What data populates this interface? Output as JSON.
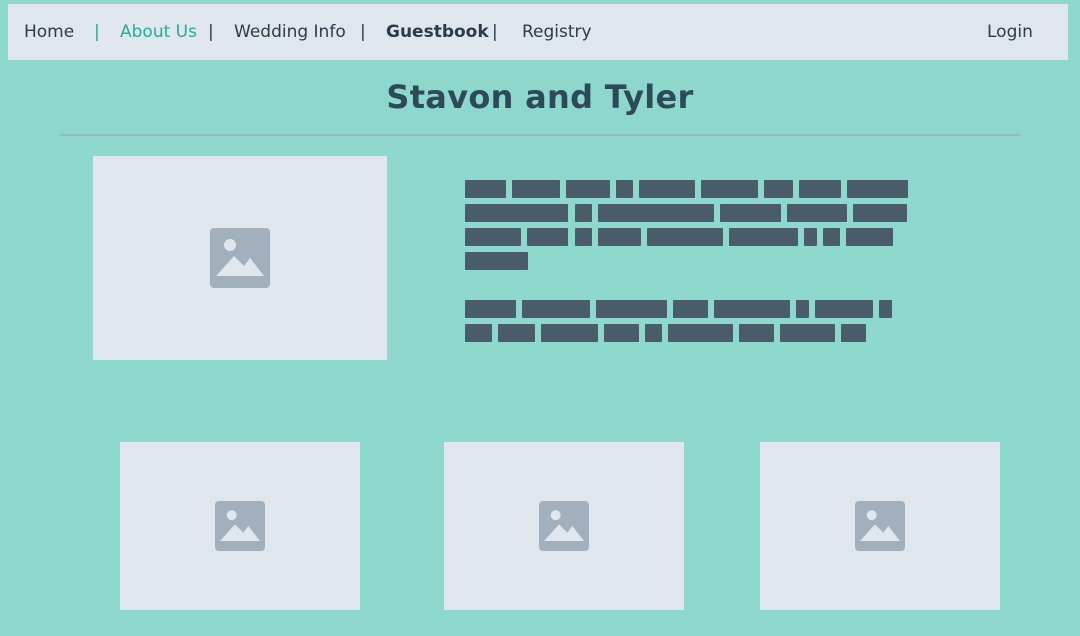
{
  "nav": {
    "home": "Home",
    "about": "About Us",
    "wedding": "Wedding Info",
    "guestbook": "Guestbook",
    "registry": "Registry",
    "login": "Login",
    "separator": "|"
  },
  "page": {
    "title": "Stavon and Tyler"
  },
  "colors": {
    "background": "#8ed7cd",
    "nav_background": "#e0e6ee",
    "accent": "#26ab9a",
    "text_dark": "#2b3b4a",
    "placeholder": "#e0e6ee",
    "placeholder_icon": "#a2b0bd",
    "text_placeholder": "#4a5c69"
  },
  "icons": {
    "hero": "image-placeholder-icon",
    "gallery": [
      "image-placeholder-icon",
      "image-placeholder-icon",
      "image-placeholder-icon"
    ]
  }
}
